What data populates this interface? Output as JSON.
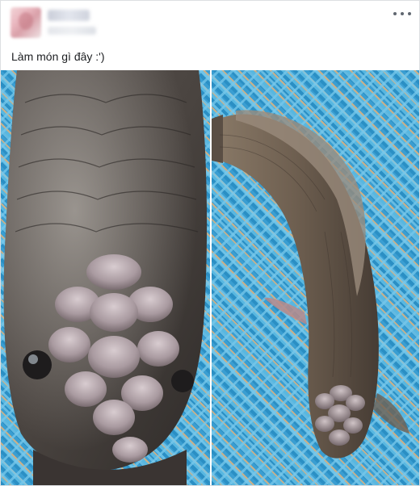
{
  "post": {
    "text": "Làm món gì đây :')"
  },
  "header": {
    "more_icon": "more-horizontal-icon"
  },
  "photos": {
    "left_subject": "snakehead-fish-head-closeup",
    "right_subject": "snakehead-fish-full-body"
  },
  "colors": {
    "basket_blue": "#3ea0cf",
    "fish_dark": "#4a4440",
    "fish_brown": "#7a6a5a",
    "text": "#1c1e21"
  }
}
